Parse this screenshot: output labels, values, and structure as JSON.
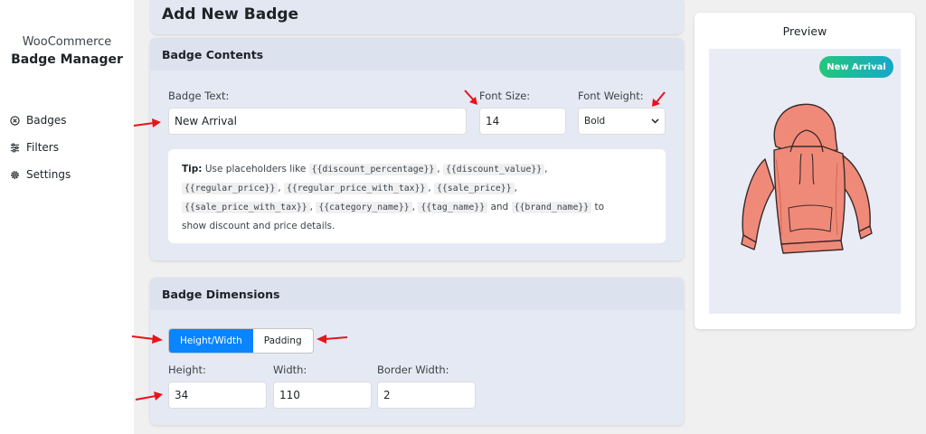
{
  "sidebar": {
    "brand_line1": "WooCommerce",
    "brand_line2": "Badge Manager",
    "items": [
      {
        "label": "Badges",
        "icon": "circle-x-icon"
      },
      {
        "label": "Filters",
        "icon": "sliders-icon"
      },
      {
        "label": "Settings",
        "icon": "gear-icon"
      }
    ]
  },
  "header": {
    "title": "Add New Badge"
  },
  "contents": {
    "title": "Badge Contents",
    "badge_text_label": "Badge Text:",
    "badge_text_value": "New Arrival",
    "font_size_label": "Font Size:",
    "font_size_value": "14",
    "font_weight_label": "Font Weight:",
    "font_weight_value": "Bold",
    "tip": {
      "lead": "Tip:",
      "intro": "Use placeholders like",
      "placeholders": [
        "{{discount_percentage}}",
        "{{discount_value}}",
        "{{regular_price}}",
        "{{regular_price_with_tax}}",
        "{{sale_price}}",
        "{{sale_price_with_tax}}",
        "{{category_name}}",
        "{{tag_name}}",
        "{{brand_name}}"
      ],
      "sep": ",",
      "and": "and",
      "to": "to",
      "outro": "show discount and price details."
    }
  },
  "dimensions": {
    "title": "Badge Dimensions",
    "tabs": [
      "Height/Width",
      "Padding"
    ],
    "height_label": "Height:",
    "height_value": "34",
    "width_label": "Width:",
    "width_value": "110",
    "border_label": "Border Width:",
    "border_value": "2"
  },
  "preview": {
    "title": "Preview",
    "badge_text": "New Arrival"
  },
  "colors": {
    "accent": "#0a84ff",
    "annotation_arrows": "#e8131b",
    "badge_gradient": [
      "#25c77b",
      "#16a8c9"
    ],
    "hoodie": "#f08a78"
  }
}
